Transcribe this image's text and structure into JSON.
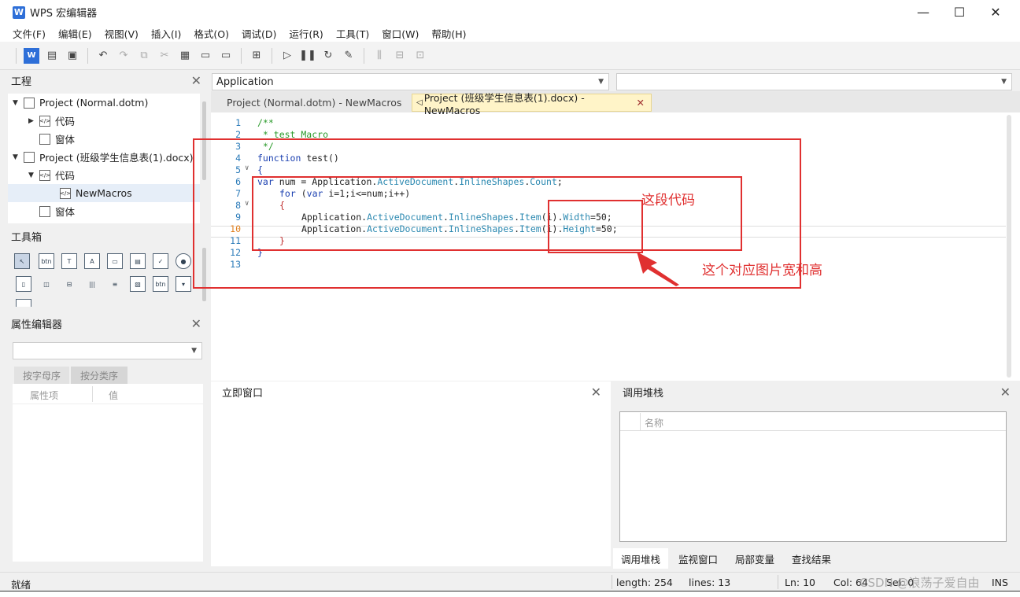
{
  "window": {
    "logo": "W",
    "title": "WPS 宏编辑器",
    "minimize": "—",
    "maximize": "☐",
    "close": "✕"
  },
  "menu": [
    "文件(F)",
    "编辑(E)",
    "视图(V)",
    "插入(I)",
    "格式(O)",
    "调试(D)",
    "运行(R)",
    "工具(T)",
    "窗口(W)",
    "帮助(H)"
  ],
  "project_panel": {
    "title": "工程",
    "tree": [
      {
        "label": "Project (Normal.dotm)",
        "icon": "project-icon"
      },
      {
        "label": "代码",
        "icon": "code-icon"
      },
      {
        "label": "窗体",
        "icon": "form-icon"
      },
      {
        "label": "Project (班级学生信息表(1).docx)",
        "icon": "project-icon"
      },
      {
        "label": "代码",
        "icon": "code-icon"
      },
      {
        "label": "NewMacros",
        "icon": "module-icon"
      },
      {
        "label": "窗体",
        "icon": "form-icon"
      }
    ]
  },
  "toolbox_panel": {
    "title": "工具箱"
  },
  "props_panel": {
    "title": "属性编辑器",
    "tabs": [
      "按字母序",
      "按分类序"
    ],
    "columns": [
      "属性项",
      "值"
    ]
  },
  "editor": {
    "object_combo": "Application",
    "proc_combo": "",
    "tabs": [
      {
        "label": "Project (Normal.dotm) - NewMacros",
        "active": false
      },
      {
        "label": "Project (班级学生信息表(1).docx) - NewMacros",
        "active": true
      }
    ],
    "line_numbers": [
      "1",
      "2",
      "3",
      "4",
      "5",
      "6",
      "7",
      "8",
      "9",
      "10",
      "11",
      "12",
      "13"
    ],
    "code": {
      "l1": "/**",
      "l2": " * test Macro",
      "l3": " */",
      "l4_kw": "function",
      "l4_rest": " test()",
      "l5": "{",
      "l6_kw": "var",
      "l6_a": " num = Application.",
      "l6_b": "ActiveDocument",
      "l6_c": ".",
      "l6_d": "InlineShapes",
      "l6_e": ".",
      "l6_f": "Count",
      "l6_g": ";",
      "l7_kw": "for",
      "l7_a": " (",
      "l7_kw2": "var",
      "l7_b": " i=1;i<=num;i++)",
      "l8": "{",
      "l9_a": "Application.",
      "l9_b": "ActiveDocument",
      "l9_c": ".",
      "l9_d": "InlineShapes",
      "l9_e": ".",
      "l9_f": "Item",
      "l9_g": "(i).",
      "l9_h": "Width",
      "l9_i": "=50;",
      "l10_h": "Height",
      "l11": "}",
      "l12": "}"
    }
  },
  "annotations": {
    "this_code": "这段代码",
    "size_note": "这个对应图片宽和高"
  },
  "immediate_panel": {
    "title": "立即窗口"
  },
  "callstack_panel": {
    "title": "调用堆栈",
    "column": "名称",
    "tabs": [
      "调用堆栈",
      "监视窗口",
      "局部变量",
      "查找结果"
    ]
  },
  "status": {
    "ready": "就绪",
    "length": "length: 254",
    "lines": "lines: 13",
    "ln": "Ln: 10",
    "col": "Col: 64",
    "sel": "Sel: 0",
    "mode": "INS",
    "watermark": "CSDN @浪荡子爱自由"
  }
}
